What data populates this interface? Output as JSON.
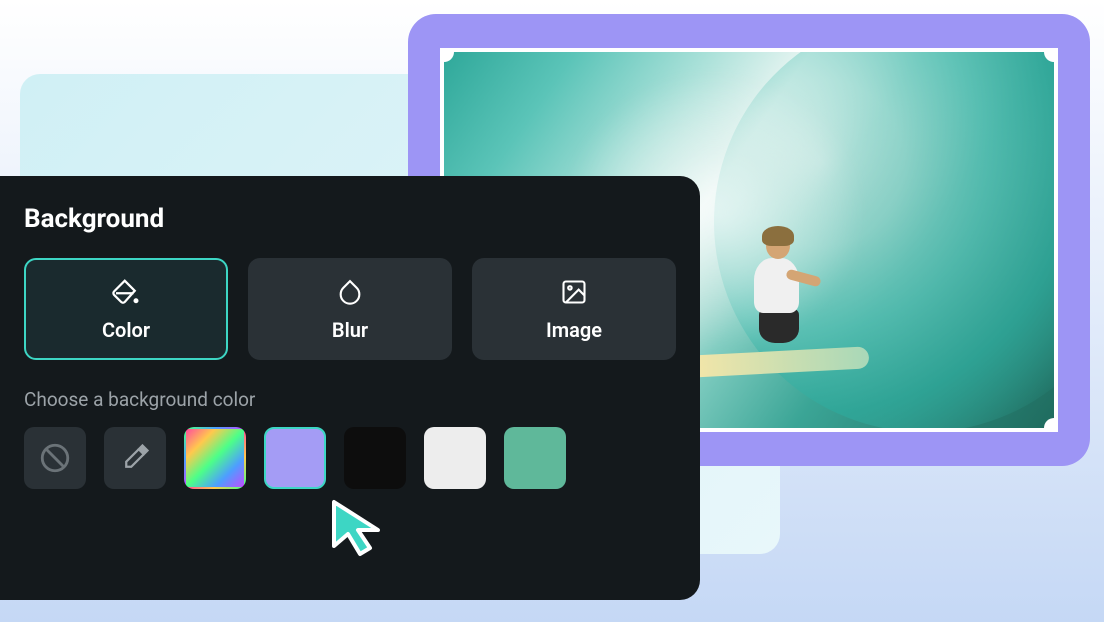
{
  "panel": {
    "title": "Background",
    "tabs": {
      "color": "Color",
      "blur": "Blur",
      "image": "Image"
    },
    "section_label": "Choose a background color",
    "swatches": {
      "none": "none",
      "picker": "eyedropper",
      "rainbow": "rainbow",
      "lavender": "#a49cf5",
      "black": "#0d0d0d",
      "white": "#ededed",
      "teal": "#5fb89a"
    },
    "selected_swatch": "lavender",
    "selected_tab": "color"
  },
  "preview": {
    "frame_color": "#9d95f5",
    "image_description": "surfer-in-wave"
  }
}
